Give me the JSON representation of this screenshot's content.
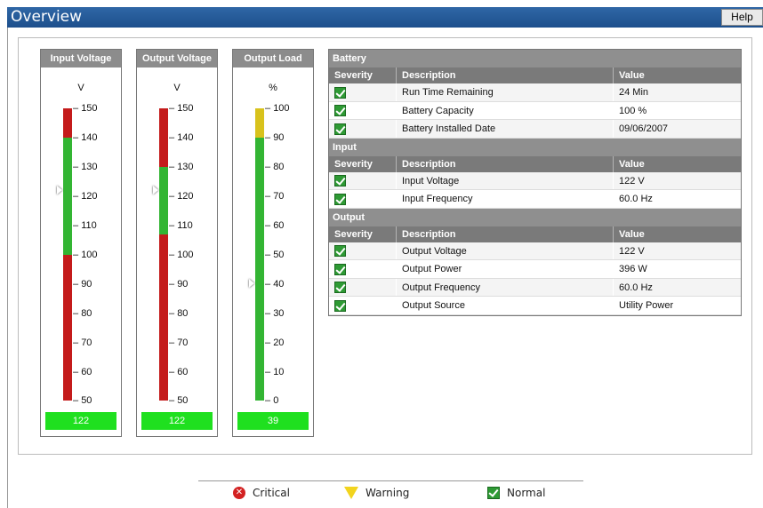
{
  "header": {
    "title": "Overview",
    "help_label": "Help"
  },
  "gauges": [
    {
      "title": "Input Voltage",
      "unit": "V",
      "ticks": [
        "150",
        "140",
        "130",
        "120",
        "110",
        "100",
        "90",
        "80",
        "70",
        "60",
        "50"
      ],
      "readout": "122"
    },
    {
      "title": "Output Voltage",
      "unit": "V",
      "ticks": [
        "150",
        "140",
        "130",
        "120",
        "110",
        "100",
        "90",
        "80",
        "70",
        "60",
        "50"
      ],
      "readout": "122"
    },
    {
      "title": "Output Load",
      "unit": "%",
      "ticks": [
        "100",
        "90",
        "80",
        "70",
        "60",
        "50",
        "40",
        "30",
        "20",
        "10",
        "0"
      ],
      "readout": "39"
    }
  ],
  "colors": {
    "critical": "#c41b1b",
    "normal": "#33b533",
    "warning": "#d8c21c",
    "readout": "#1fe01f"
  },
  "sections": [
    {
      "title": "Battery",
      "headers": [
        "Severity",
        "Description",
        "Value"
      ],
      "rows": [
        {
          "description": "Run Time Remaining",
          "value": "24 Min"
        },
        {
          "description": "Battery Capacity",
          "value": "100 %"
        },
        {
          "description": "Battery Installed Date",
          "value": "09/06/2007"
        }
      ]
    },
    {
      "title": "Input",
      "headers": [
        "Severity",
        "Description",
        "Value"
      ],
      "rows": [
        {
          "description": "Input Voltage",
          "value": "122 V"
        },
        {
          "description": "Input Frequency",
          "value": "60.0 Hz"
        }
      ]
    },
    {
      "title": "Output",
      "headers": [
        "Severity",
        "Description",
        "Value"
      ],
      "rows": [
        {
          "description": "Output Voltage",
          "value": "122 V"
        },
        {
          "description": "Output Power",
          "value": "396 W"
        },
        {
          "description": "Output Frequency",
          "value": "60.0 Hz"
        },
        {
          "description": "Output Source",
          "value": "Utility Power"
        }
      ]
    }
  ],
  "legend": {
    "critical": "Critical",
    "warning": "Warning",
    "normal": "Normal"
  }
}
